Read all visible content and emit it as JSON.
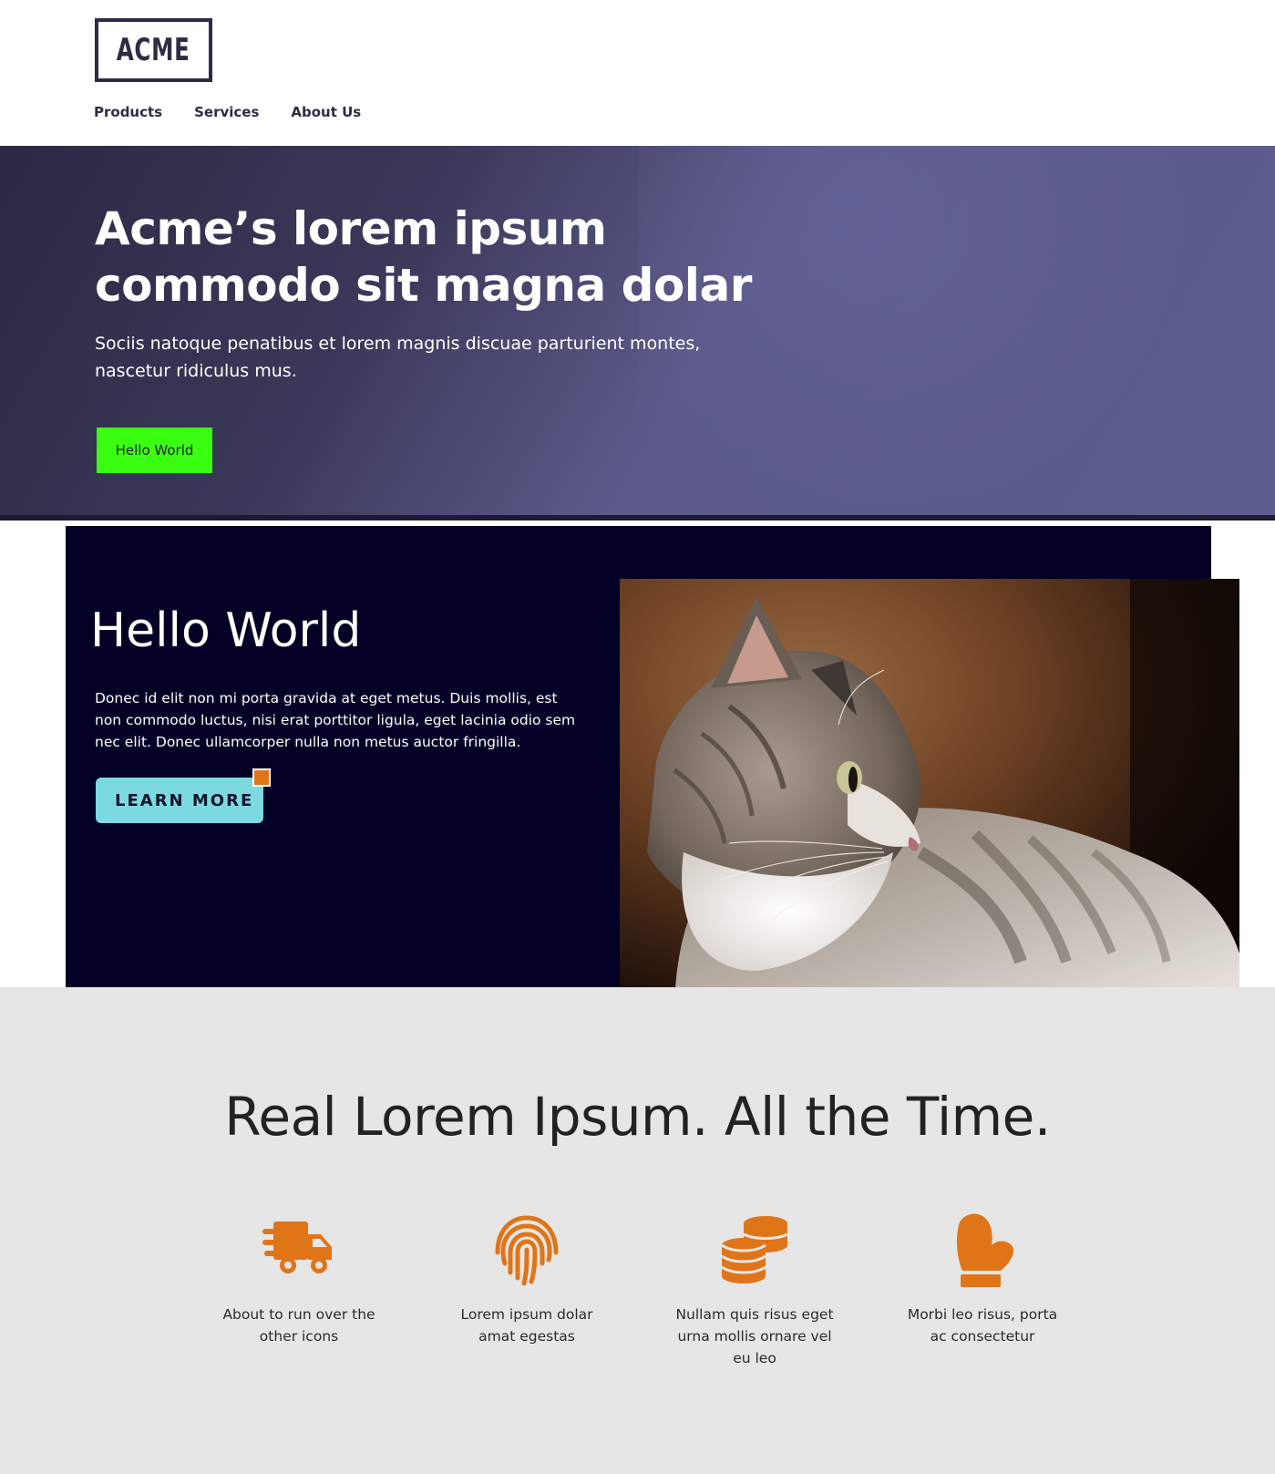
{
  "header": {
    "logo_text": "ACME",
    "nav": [
      {
        "label": "Products"
      },
      {
        "label": "Services"
      },
      {
        "label": "About Us"
      }
    ]
  },
  "hero": {
    "title": "Acme’s lorem ipsum commodo sit magna dolar",
    "subtitle": "Sociis natoque penatibus et lorem magnis discuae parturient montes, nascetur ridiculus mus.",
    "button_label": "Hello World",
    "button_color": "#3bff12"
  },
  "feature": {
    "title": "Hello World",
    "text": "Donec id elit non mi porta gravida at eget metus. Duis mollis, est non commodo luctus, nisi erat porttitor ligula, eget lacinia odio sem nec elit. Donec ullamcorper nulla non metus auctor fringilla.",
    "button_label": "LEARN MORE",
    "button_color": "#7cd9e2",
    "image_icon": "cat-photo"
  },
  "benefits": {
    "title": "Real Lorem Ipsum. All the Time.",
    "accent": "#e07518",
    "items": [
      {
        "icon": "delivery-truck-icon",
        "label": "About to run over the other icons"
      },
      {
        "icon": "fingerprint-icon",
        "label": "Lorem ipsum dolar amat egestas"
      },
      {
        "icon": "coins-icon",
        "label": "Nullam quis risus eget urna mollis ornare vel eu leo"
      },
      {
        "icon": "mitten-icon",
        "label": "Morbi leo risus, porta ac consectetur"
      }
    ]
  }
}
